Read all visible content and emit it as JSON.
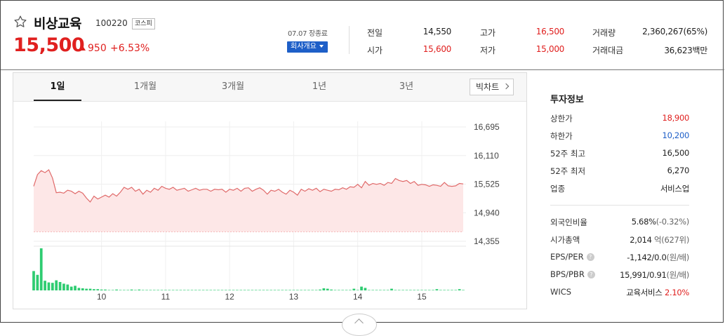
{
  "header": {
    "name": "비상교육",
    "code": "100220",
    "market": "코스피",
    "price": "15,500",
    "change_amount": "950",
    "change_rate": "+6.53%",
    "as_of": "07.07 장종료",
    "overview_label": "회사개요"
  },
  "quote": {
    "prev_close_label": "전일",
    "prev_close": "14,550",
    "open_label": "시가",
    "open": "15,600",
    "high_label": "고가",
    "high": "16,500",
    "low_label": "저가",
    "low": "15,000",
    "volume_label": "거래량",
    "volume": "2,360,267(65%)",
    "turnover_label": "거래대금",
    "turnover": "36,623백만"
  },
  "tabs": [
    "1일",
    "1개월",
    "3개월",
    "1년",
    "3년"
  ],
  "bigchart_label": "빅차트",
  "colors": {
    "up": "#e0201f",
    "down": "#1e5fc8",
    "line": "#e06a6a",
    "volume": "#2ecc71"
  },
  "chart_data": {
    "type": "line",
    "yticks": [
      16695,
      16110,
      15525,
      14940,
      14355
    ],
    "ylim": [
      14355,
      16695
    ],
    "base": 14550,
    "xticks": [
      {
        "label": "10",
        "index": 18
      },
      {
        "label": "11",
        "index": 35
      },
      {
        "label": "12",
        "index": 52
      },
      {
        "label": "13",
        "index": 69
      },
      {
        "label": "14",
        "index": 86
      },
      {
        "label": "15",
        "index": 103
      }
    ],
    "values": [
      15480,
      15720,
      15800,
      15760,
      15820,
      15650,
      15350,
      15360,
      15340,
      15400,
      15380,
      15330,
      15380,
      15340,
      15240,
      15160,
      15280,
      15220,
      15260,
      15300,
      15260,
      15330,
      15280,
      15360,
      15460,
      15420,
      15460,
      15380,
      15420,
      15320,
      15400,
      15360,
      15440,
      15400,
      15480,
      15440,
      15420,
      15460,
      15400,
      15420,
      15440,
      15380,
      15410,
      15440,
      15400,
      15420,
      15420,
      15380,
      15420,
      15410,
      15420,
      15360,
      15420,
      15400,
      15440,
      15380,
      15440,
      15450,
      15380,
      15420,
      15450,
      15400,
      15320,
      15400,
      15380,
      15420,
      15360,
      15320,
      15400,
      15360,
      15300,
      15420,
      15380,
      15430,
      15400,
      15440,
      15370,
      15420,
      15400,
      15380,
      15420,
      15410,
      15450,
      15420,
      15470,
      15460,
      15520,
      15450,
      15580,
      15500,
      15540,
      15520,
      15540,
      15500,
      15560,
      15540,
      15640,
      15600,
      15580,
      15600,
      15540,
      15580,
      15500,
      15520,
      15510,
      15480,
      15510,
      15500,
      15480,
      15560,
      15490,
      15480,
      15490,
      15540,
      15530
    ],
    "volume": [
      46,
      37,
      100,
      23,
      19,
      18,
      24,
      20,
      16,
      14,
      9,
      11,
      6,
      5,
      4,
      4,
      3,
      3,
      2,
      2,
      1,
      1,
      2,
      1,
      1,
      1,
      2,
      1,
      2,
      1,
      1,
      1,
      1,
      1,
      1,
      1,
      1,
      1,
      1,
      1,
      1,
      1,
      1,
      1,
      1,
      1,
      1,
      1,
      1,
      1,
      1,
      1,
      1,
      1,
      1,
      1,
      1,
      1,
      1,
      1,
      1,
      1,
      1,
      1,
      1,
      1,
      1,
      1,
      1,
      1,
      1,
      1,
      1,
      1,
      1,
      1,
      2,
      5,
      4,
      2,
      1,
      1,
      1,
      1,
      1,
      4,
      1,
      9,
      6,
      1,
      1,
      1,
      1,
      1,
      1,
      4,
      1,
      1,
      1,
      1,
      1,
      1,
      1,
      1,
      1,
      1,
      1,
      3,
      1,
      1,
      1,
      1,
      1,
      3,
      1
    ]
  },
  "invest": {
    "title": "투자정보",
    "rows": [
      {
        "label": "상한가",
        "value": "18,900",
        "cls": "up"
      },
      {
        "label": "하한가",
        "value": "10,200",
        "cls": "down"
      },
      {
        "label": "52주 최고",
        "value": "16,500",
        "cls": ""
      },
      {
        "label": "52주 최저",
        "value": "6,270",
        "cls": ""
      },
      {
        "label": "업종",
        "value": "서비스업",
        "cls": ""
      }
    ],
    "foreign_label": "외국인비율",
    "foreign_value": "5.68%",
    "foreign_sub": "(-0.32%)",
    "mcap_label": "시가총액",
    "mcap_value": "2,014",
    "mcap_unit": "억",
    "mcap_rank": "(627위)",
    "eps_label": "EPS/PER",
    "eps_value": "-1,142/0.0",
    "eps_unit": "(원/배)",
    "bps_label": "BPS/PBR",
    "bps_value": "15,991/0.91",
    "bps_unit": "(원/배)",
    "wics_label": "WICS",
    "wics_value": "교육서비스",
    "wics_rate": "2.10%",
    "help_glyph": "?"
  }
}
